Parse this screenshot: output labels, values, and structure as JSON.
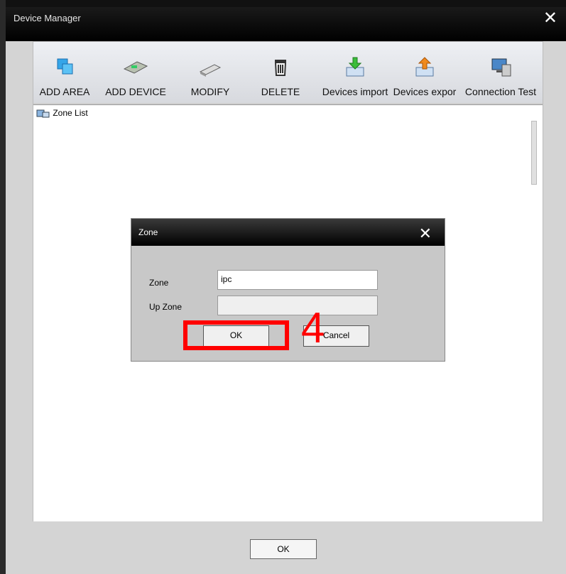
{
  "window": {
    "title": "Device Manager",
    "close": "✕"
  },
  "toolbar": {
    "buttons": [
      {
        "label": "ADD AREA",
        "icon": "add-area-icon"
      },
      {
        "label": "ADD DEVICE",
        "icon": "add-device-icon"
      },
      {
        "label": "MODIFY",
        "icon": "modify-icon"
      },
      {
        "label": "DELETE",
        "icon": "trash-icon"
      },
      {
        "label": "Devices import",
        "icon": "import-icon"
      },
      {
        "label": "Devices expor",
        "icon": "export-icon"
      },
      {
        "label": "Connection  Test",
        "icon": "connection-test-icon"
      }
    ]
  },
  "tree": {
    "root": "Zone List"
  },
  "footer": {
    "ok": "OK"
  },
  "dialog": {
    "title": "Zone",
    "close": "✕",
    "zone_label": "Zone",
    "zone_value": "ipc",
    "up_zone_label": "Up Zone",
    "up_zone_value": "",
    "ok": "OK",
    "cancel": "Cancel"
  },
  "annotation": {
    "step": "4",
    "color": "#ff0000"
  }
}
